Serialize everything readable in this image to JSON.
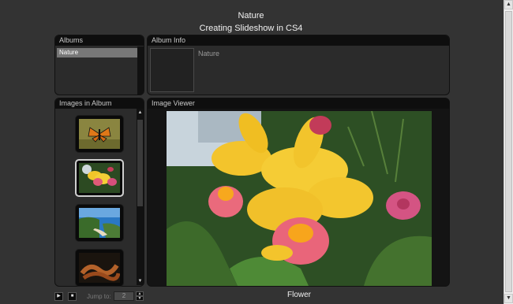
{
  "header": {
    "gallery_title": "Nature",
    "subtitle": "Creating Slideshow in CS4"
  },
  "albums_panel": {
    "title": "Albums",
    "items": [
      {
        "label": "Nature",
        "selected": true
      }
    ]
  },
  "album_info_panel": {
    "title": "Album Info",
    "album_name": "Nature"
  },
  "images_panel": {
    "title": "Images in Album",
    "thumbnails": [
      {
        "icon": "butterfly-thumbnail",
        "selected": false
      },
      {
        "icon": "orchid-thumbnail",
        "selected": true
      },
      {
        "icon": "coastline-thumbnail",
        "selected": false
      },
      {
        "icon": "snake-thumbnail",
        "selected": false
      }
    ]
  },
  "viewer_panel": {
    "title": "Image Viewer",
    "image_icon": "yellow-orchid-photo",
    "caption": "Flower"
  },
  "controls": {
    "prev_icon": "play-icon",
    "next_icon": "stop-icon",
    "jump_label": "Jump to:",
    "jump_value": "2"
  },
  "colors": {
    "background": "#333333",
    "panel_header": "#0e0e0e",
    "panel_body": "#2b2b2b",
    "selected_item": "#777777"
  }
}
